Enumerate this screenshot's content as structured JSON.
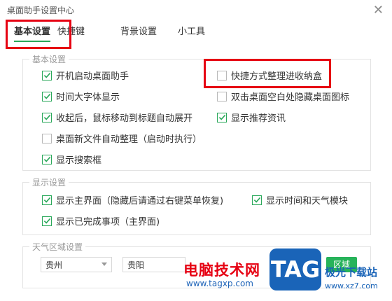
{
  "window": {
    "title": "桌面助手设置中心",
    "close_glyph": "✕"
  },
  "tabs": [
    {
      "label": "基本设置",
      "active": true
    },
    {
      "label": "快捷键",
      "active": false
    },
    {
      "label": "背景设置",
      "active": false
    },
    {
      "label": "小工具",
      "active": false
    }
  ],
  "basic": {
    "title": "基本设置",
    "options": [
      {
        "label": "开机启动桌面助手",
        "checked": true
      },
      {
        "label": "时间大字体显示",
        "checked": true
      },
      {
        "label": "收起后，鼠标移动到标题自动展开",
        "checked": true
      },
      {
        "label": "桌面新文件自动整理（启动时执行）",
        "checked": false
      },
      {
        "label": "显示搜索框",
        "checked": true
      },
      {
        "label": "快捷方式整理进收纳盒",
        "checked": false
      },
      {
        "label": "双击桌面空白处隐藏桌面图标",
        "checked": false
      },
      {
        "label": "显示推荐资讯",
        "checked": true
      }
    ]
  },
  "display": {
    "title": "显示设置",
    "options": [
      {
        "label": "显示主界面（隐藏后请通过右键菜单恢复)",
        "checked": true
      },
      {
        "label": "显示已完成事项（主界面)",
        "checked": true
      },
      {
        "label": "显示时间和天气模块",
        "checked": true
      }
    ]
  },
  "weather": {
    "title": "天气区域设置",
    "province": "贵州",
    "city": "贵阳",
    "button_label": "区域"
  },
  "watermark": {
    "cn": "电脑技术网",
    "url": "www.tagxp.com",
    "tag": "TAG",
    "dl": "极光下载站",
    "url2": "www.xz7.com"
  },
  "colors": {
    "accent": "#2aa85a",
    "highlight": "#e60012"
  }
}
